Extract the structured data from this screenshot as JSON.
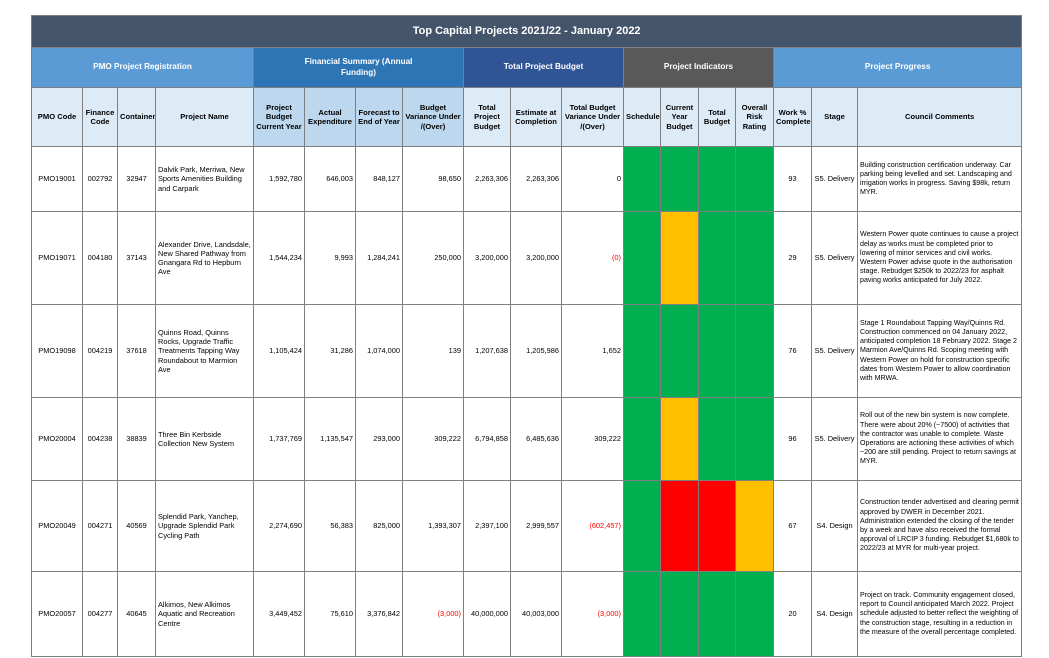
{
  "title": "Top Capital Projects 2021/22 - January 2022",
  "groups": {
    "registration": "PMO Project Registration",
    "financial": "Financial Summary (Annual Funding)",
    "total_budget": "Total Project Budget",
    "indicators": "Project Indicators",
    "progress": "Project Progress"
  },
  "columns": {
    "pmo_code": "PMO Code",
    "finance_code": "Finance Code",
    "container": "Container",
    "project_name": "Project Name",
    "budget_cy": "Project Budget Current Year",
    "actual_exp": "Actual Expenditure",
    "forecast": "Forecast to End of Year",
    "variance": "Budget Variance Under /(Over)",
    "total_budget": "Total Project Budget",
    "estimate": "Estimate at Completion",
    "total_variance": "Total Budget Variance Under /(Over)",
    "schedule": "Schedule",
    "cy_budget": "Current Year Budget",
    "total_budget_ind": "Total Budget",
    "risk": "Overall Risk Rating",
    "work_pct": "Work % Complete",
    "stage": "Stage",
    "comments": "Council Comments"
  },
  "colors": {
    "green": "#00b050",
    "amber": "#ffc000",
    "red": "#ff0000"
  },
  "rows": [
    {
      "pmo_code": "PMO19001",
      "finance_code": "002792",
      "container": "32947",
      "project_name": "Dalvik Park, Merriwa, New Sports Amenities Building and Carpark",
      "budget_cy": "1,592,780",
      "actual_exp": "646,003",
      "forecast": "848,127",
      "variance": "98,650",
      "total_budget": "2,263,306",
      "estimate": "2,263,306",
      "total_variance": "0",
      "indicators": [
        "green",
        "green",
        "green",
        "green"
      ],
      "work_pct": "93",
      "stage": "S5. Delivery",
      "comments": "Building construction certification underway. Car parking being levelled and set. Landscaping and irrigation works in progress. Saving $98k, return MYR."
    },
    {
      "pmo_code": "PMO19071",
      "finance_code": "004180",
      "container": "37143",
      "project_name": "Alexander Drive, Landsdale, New Shared Pathway from Gnangara Rd to Hepburn Ave",
      "budget_cy": "1,544,234",
      "actual_exp": "9,993",
      "forecast": "1,284,241",
      "variance": "250,000",
      "total_budget": "3,200,000",
      "estimate": "3,200,000",
      "total_variance": "(0)",
      "indicators": [
        "green",
        "amber",
        "green",
        "green"
      ],
      "work_pct": "29",
      "stage": "S5. Delivery",
      "comments": "Western Power quote continues to cause a project delay as works must be completed prior to lowering of minor services and civil works. Western Power advise quote in the authorisation stage. Rebudget $250k to 2022/23 for asphalt paving works anticipated for July 2022."
    },
    {
      "pmo_code": "PMO19098",
      "finance_code": "004219",
      "container": "37618",
      "project_name": "Quinns Road, Quinns Rocks, Upgrade Traffic Treatments Tapping Way Roundabout to Marmion Ave",
      "budget_cy": "1,105,424",
      "actual_exp": "31,286",
      "forecast": "1,074,000",
      "variance": "139",
      "total_budget": "1,207,638",
      "estimate": "1,205,986",
      "total_variance": "1,652",
      "indicators": [
        "green",
        "green",
        "green",
        "green"
      ],
      "work_pct": "76",
      "stage": "S5. Delivery",
      "comments": "Stage 1 Roundabout Tapping Way/Quinns Rd. Construction commenced on 04 January 2022, anticipated completion 18 February 2022. Stage 2 Marmion Ave/Quinns Rd. Scoping meeting with Western Power on hold for construction specific dates from Western Power to allow coordination with MRWA."
    },
    {
      "pmo_code": "PMO20004",
      "finance_code": "004238",
      "container": "38839",
      "project_name": "Three Bin Kerbside Collection New System",
      "budget_cy": "1,737,769",
      "actual_exp": "1,135,547",
      "forecast": "293,000",
      "variance": "309,222",
      "total_budget": "6,794,858",
      "estimate": "6,485,636",
      "total_variance": "309,222",
      "indicators": [
        "green",
        "amber",
        "green",
        "green"
      ],
      "work_pct": "96",
      "stage": "S5. Delivery",
      "comments": "Roll out of the new bin system is now complete. There were about 20% (~7500) of activities that the contractor was unable to complete. Waste Operations are actioning these activities of which ~200 are still pending. Project to return savings at MYR."
    },
    {
      "pmo_code": "PMO20049",
      "finance_code": "004271",
      "container": "40569",
      "project_name": "Splendid Park, Yanchep, Upgrade Splendid Park Cycling Path",
      "budget_cy": "2,274,690",
      "actual_exp": "56,383",
      "forecast": "825,000",
      "variance": "1,393,307",
      "total_budget": "2,397,100",
      "estimate": "2,999,557",
      "total_variance": "(602,457)",
      "indicators": [
        "green",
        "red",
        "red",
        "amber"
      ],
      "work_pct": "67",
      "stage": "S4. Design",
      "comments": "Construction tender advertised and clearing permit approved by DWER in December 2021. Administration extended the closing of the tender by a week and have also received the formal approval of LRCIP 3 funding. Rebudget $1,680k to 2022/23 at MYR for multi-year project."
    },
    {
      "pmo_code": "PMO20057",
      "finance_code": "004277",
      "container": "40645",
      "project_name": "Alkimos, New Alkimos Aquatic and Recreation Centre",
      "budget_cy": "3,449,452",
      "actual_exp": "75,610",
      "forecast": "3,376,842",
      "variance": "(3,000)",
      "total_budget": "40,000,000",
      "estimate": "40,003,000",
      "total_variance": "(3,000)",
      "indicators": [
        "green",
        "green",
        "green",
        "green"
      ],
      "work_pct": "20",
      "stage": "S4. Design",
      "comments": "Project on track. Community engagement closed, report to Council anticipated March 2022. Project schedule adjusted to better reflect the weighting of the construction stage, resulting in a reduction in the measure of the overall percentage completed."
    }
  ]
}
